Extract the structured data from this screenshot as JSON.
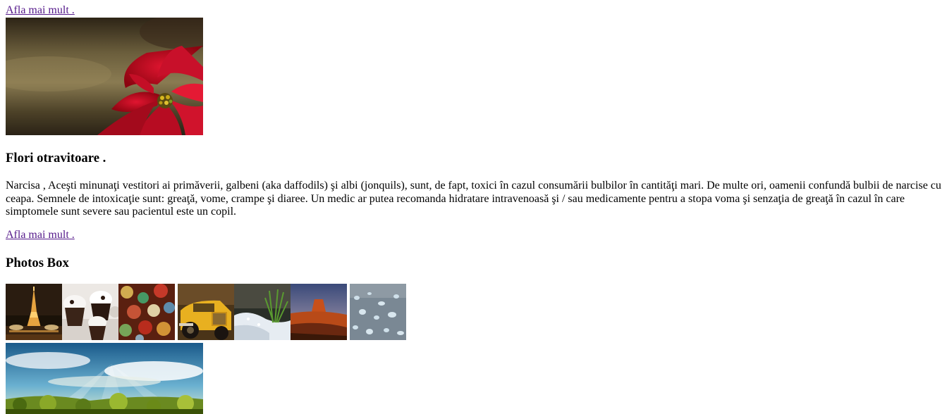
{
  "links": {
    "more_top": "Afla mai mult .",
    "more_bottom": "Afla mai mult ."
  },
  "article": {
    "heading": "Flori otravitoare .",
    "lines": [
      "Narcisa , Aceşti minunaţi vestitori ai primăverii, galbeni (aka daffodils) şi albi (jonquils), sunt, de fapt, toxici în cazul consumării bulbilor în cantităţi mari. De multe ori, oamenii confundă bulbii de narcise cu",
      "ceapa. Semnele de intoxicaţie sunt: greaţă, vome, crampe şi diaree. Un medic ar putea recomanda hidratare intravenoasă şi / sau medicamente pentru a stopa voma şi senzaţia de greaţă în cazul în care",
      "simptomele sunt severe sau pacientul este un copil."
    ]
  },
  "photos": {
    "heading": "Photos Box",
    "thumbnails": [
      "eiffel-tower-night",
      "cupcakes",
      "bokeh-lights",
      "yellow-vintage-truck",
      "snow-grass",
      "desert-butte",
      "water-droplets"
    ],
    "featured": "landscape-sunrays"
  },
  "colors": {
    "link": "#551a8b",
    "text": "#000000",
    "background": "#ffffff"
  }
}
